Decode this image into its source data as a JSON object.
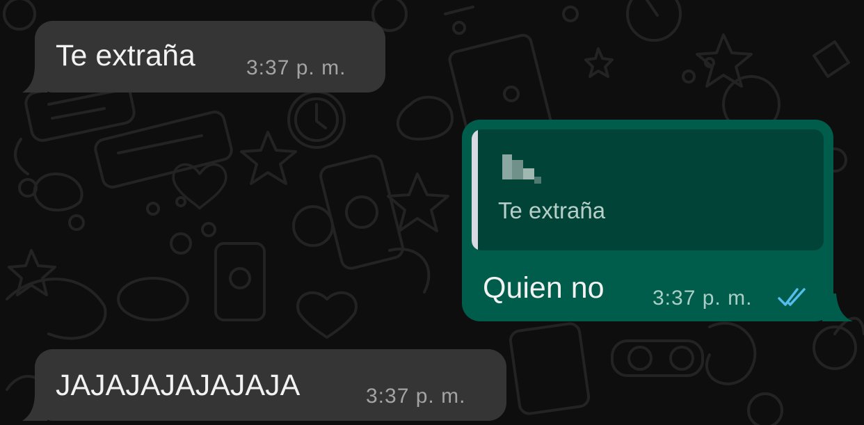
{
  "messages": [
    {
      "direction": "incoming",
      "text": "Te extraña",
      "time": "3:37 p. m."
    },
    {
      "direction": "outgoing",
      "quoted": {
        "author": "",
        "text": "Te extraña"
      },
      "text": "Quien no",
      "time": "3:37 p. m.",
      "status_icon": "double-check-read-icon"
    },
    {
      "direction": "incoming",
      "text": "JAJAJAJAJAJAJA",
      "time": "3:37 p. m."
    }
  ],
  "colors": {
    "background": "#0e0e0e",
    "incoming_bubble": "#353535",
    "outgoing_bubble": "#005c4b",
    "quote_background": "#024337",
    "read_ticks": "#53bdeb"
  }
}
